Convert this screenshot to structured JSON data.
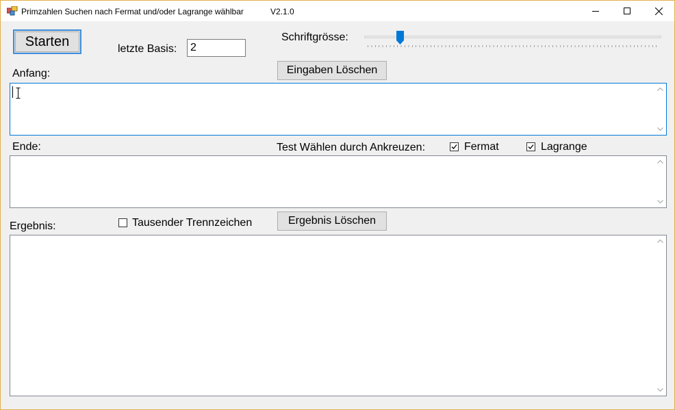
{
  "window": {
    "title": "Primzahlen Suchen nach Fermat und/oder Lagrange wählbar",
    "version": "V2.1.0",
    "controls": [
      "minimize-icon",
      "maximize-icon",
      "close-icon"
    ]
  },
  "toolbar": {
    "start_label": "Starten",
    "basis_label": "letzte Basis:",
    "basis_value": "2",
    "font_size_label": "Schriftgrösse:",
    "font_size_slider_fraction": 0.12,
    "clear_inputs_label": "Eingaben Löschen"
  },
  "fields": {
    "start_label": "Anfang:",
    "start_value": "",
    "end_label": "Ende:",
    "end_value": "",
    "result_label": "Ergebnis:",
    "result_value": ""
  },
  "tests": {
    "choose_label": "Test Wählen durch Ankreuzen:",
    "fermat_label": "Fermat",
    "fermat_checked": true,
    "lagrange_label": "Lagrange",
    "lagrange_checked": true
  },
  "result_options": {
    "thousands_separator_label": "Tausender Trennzeichen",
    "thousands_separator_checked": false,
    "clear_result_label": "Ergebnis Löschen"
  },
  "colors": {
    "accent": "#0078d7",
    "window_border": "#e3b04a",
    "background": "#f0f0f0"
  }
}
